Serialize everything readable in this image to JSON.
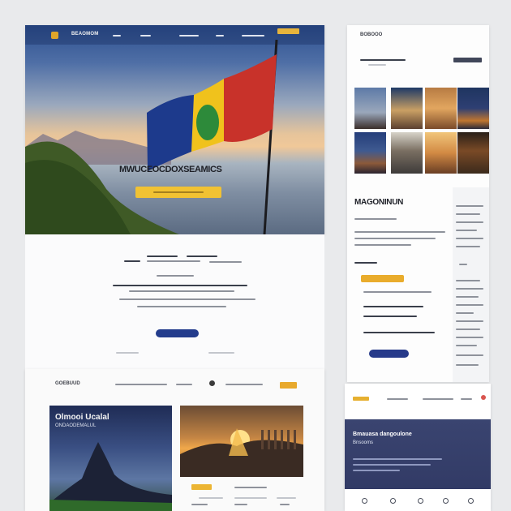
{
  "hero": {
    "logo_text": "BEAOMOM",
    "nav_links": [
      "",
      "",
      "",
      "",
      ""
    ],
    "title": "MWUCEOCDOXSEAMICS",
    "cta_label": ""
  },
  "intro": {
    "button_label": ""
  },
  "gallery": {
    "logo_text": "GOEBUUD",
    "card1_title": "Olmooi Ucalal",
    "card1_subtitle": "ONDAODEMALUL"
  },
  "side": {
    "logo_text": "BOBOOO",
    "heading": "MAGONINUN"
  },
  "mini": {
    "title": "Bmauasa dangoulone",
    "subtitle": "Bnsooms"
  },
  "colors": {
    "accent_yellow": "#f1c233",
    "accent_navy": "#233c8c",
    "flag_red": "#c8322a",
    "flag_yellow": "#f0c21c",
    "flag_blue": "#1d3a8c",
    "flag_green": "#2d8a3a"
  }
}
